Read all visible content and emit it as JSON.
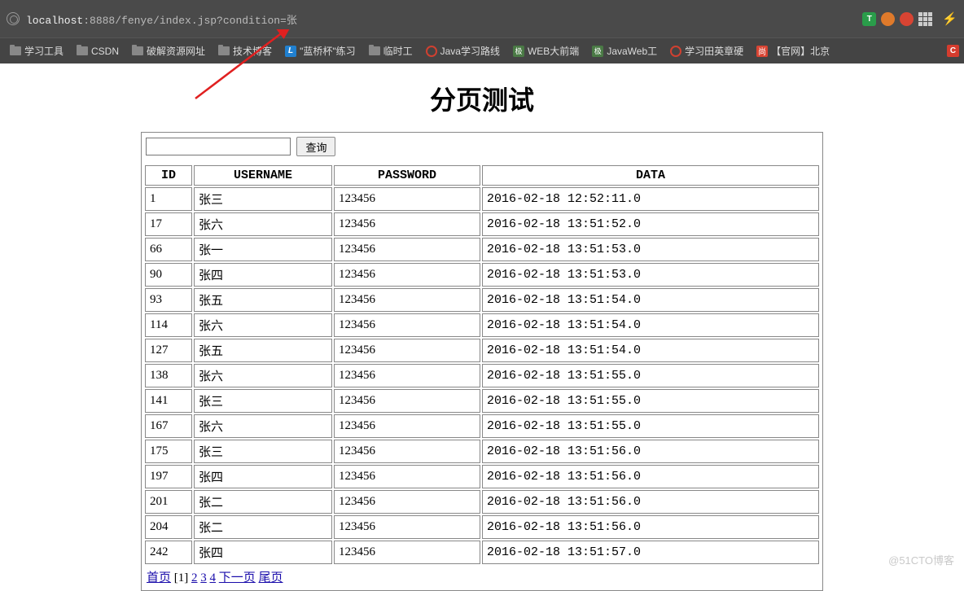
{
  "url": {
    "host": "localhost",
    "rest": ":8888/fenye/index.jsp?condition=张"
  },
  "toolbar_badge": "T",
  "bookmarks": [
    {
      "label": "学习工具",
      "icon": "folder"
    },
    {
      "label": "CSDN",
      "icon": "folder"
    },
    {
      "label": "破解资源网址",
      "icon": "folder"
    },
    {
      "label": "技术博客",
      "icon": "folder"
    },
    {
      "label": "\"蓝桥杯\"练习",
      "icon": "lanqiao"
    },
    {
      "label": "临时工",
      "icon": "folder"
    },
    {
      "label": "Java学习路线",
      "icon": "opera"
    },
    {
      "label": "WEB大前端",
      "icon": "ji"
    },
    {
      "label": "JavaWeb工",
      "icon": "ji"
    },
    {
      "label": "学习田英章硬",
      "icon": "opera"
    },
    {
      "label": "【官网】北京",
      "icon": "shang"
    }
  ],
  "csdn_corner": "C",
  "page": {
    "title": "分页测试",
    "search": {
      "value": "",
      "button": "查询"
    },
    "headers": {
      "id": "ID",
      "username": "USERNAME",
      "password": "PASSWORD",
      "data": "DATA"
    },
    "rows": [
      {
        "id": "1",
        "username": "张三",
        "password": "123456",
        "data": "2016-02-18 12:52:11.0"
      },
      {
        "id": "17",
        "username": "张六",
        "password": "123456",
        "data": "2016-02-18 13:51:52.0"
      },
      {
        "id": "66",
        "username": "张一",
        "password": "123456",
        "data": "2016-02-18 13:51:53.0"
      },
      {
        "id": "90",
        "username": "张四",
        "password": "123456",
        "data": "2016-02-18 13:51:53.0"
      },
      {
        "id": "93",
        "username": "张五",
        "password": "123456",
        "data": "2016-02-18 13:51:54.0"
      },
      {
        "id": "114",
        "username": "张六",
        "password": "123456",
        "data": "2016-02-18 13:51:54.0"
      },
      {
        "id": "127",
        "username": "张五",
        "password": "123456",
        "data": "2016-02-18 13:51:54.0"
      },
      {
        "id": "138",
        "username": "张六",
        "password": "123456",
        "data": "2016-02-18 13:51:55.0"
      },
      {
        "id": "141",
        "username": "张三",
        "password": "123456",
        "data": "2016-02-18 13:51:55.0"
      },
      {
        "id": "167",
        "username": "张六",
        "password": "123456",
        "data": "2016-02-18 13:51:55.0"
      },
      {
        "id": "175",
        "username": "张三",
        "password": "123456",
        "data": "2016-02-18 13:51:56.0"
      },
      {
        "id": "197",
        "username": "张四",
        "password": "123456",
        "data": "2016-02-18 13:51:56.0"
      },
      {
        "id": "201",
        "username": "张二",
        "password": "123456",
        "data": "2016-02-18 13:51:56.0"
      },
      {
        "id": "204",
        "username": "张二",
        "password": "123456",
        "data": "2016-02-18 13:51:56.0"
      },
      {
        "id": "242",
        "username": "张四",
        "password": "123456",
        "data": "2016-02-18 13:51:57.0"
      }
    ],
    "pager": {
      "first": "首页",
      "current_display": "[1]",
      "pages": [
        "2",
        "3",
        "4"
      ],
      "next": "下一页",
      "last": "尾页"
    }
  },
  "watermark": "@51CTO博客"
}
